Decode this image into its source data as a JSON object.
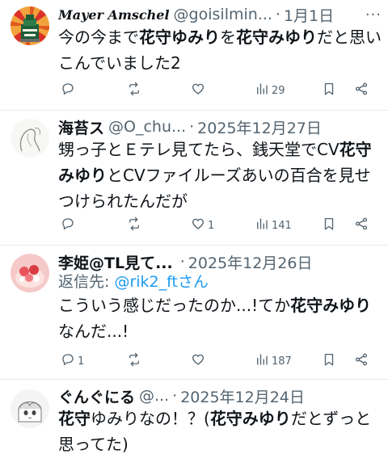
{
  "tweets": [
    {
      "name": "Mayer Amschel",
      "handle": "@goisilmin...",
      "date": "1月1日",
      "body": [
        {
          "t": "今の今まで"
        },
        {
          "t": "花守ゆみり",
          "b": true
        },
        {
          "t": "を"
        },
        {
          "t": "花守みゆり",
          "b": true
        },
        {
          "t": "だと思いこんでいました2"
        }
      ],
      "stats": {
        "replies": "",
        "retweets": "",
        "likes": "",
        "views": "29"
      }
    },
    {
      "name": "海苔ス",
      "handle": "@O_chu...",
      "date": "2025年12月27日",
      "body": [
        {
          "t": "甥っ子とＥテレ見てたら、銭天堂でCV"
        },
        {
          "t": "花守みゆり",
          "b": true
        },
        {
          "t": "とCVファイルーズあいの百合を見せつけられたんだが"
        }
      ],
      "stats": {
        "replies": "",
        "retweets": "",
        "likes": "1",
        "views": "141"
      }
    },
    {
      "name": "李姫@TL見て...",
      "handle": "",
      "date": "2025年12月26日",
      "reply_to_label": "返信先:",
      "reply_to_user": "@rik2_ftさん",
      "body": [
        {
          "t": "こういう感じだったのか...!てか"
        },
        {
          "t": "花守みゆり",
          "b": true
        },
        {
          "t": "なんだ...!"
        }
      ],
      "stats": {
        "replies": "1",
        "retweets": "",
        "likes": "",
        "views": "187"
      }
    },
    {
      "name": "ぐんぐにる",
      "handle": "@...",
      "date": "2025年12月24日",
      "body": [
        {
          "t": "花守",
          "b": true
        },
        {
          "t": "ゆみりなの！？("
        },
        {
          "t": "花守みゆり",
          "b": true
        },
        {
          "t": "だとずっと思ってた)"
        }
      ],
      "stats": {}
    }
  ],
  "ui": {
    "dot": "·",
    "more_icon": "more-dots-icon"
  }
}
